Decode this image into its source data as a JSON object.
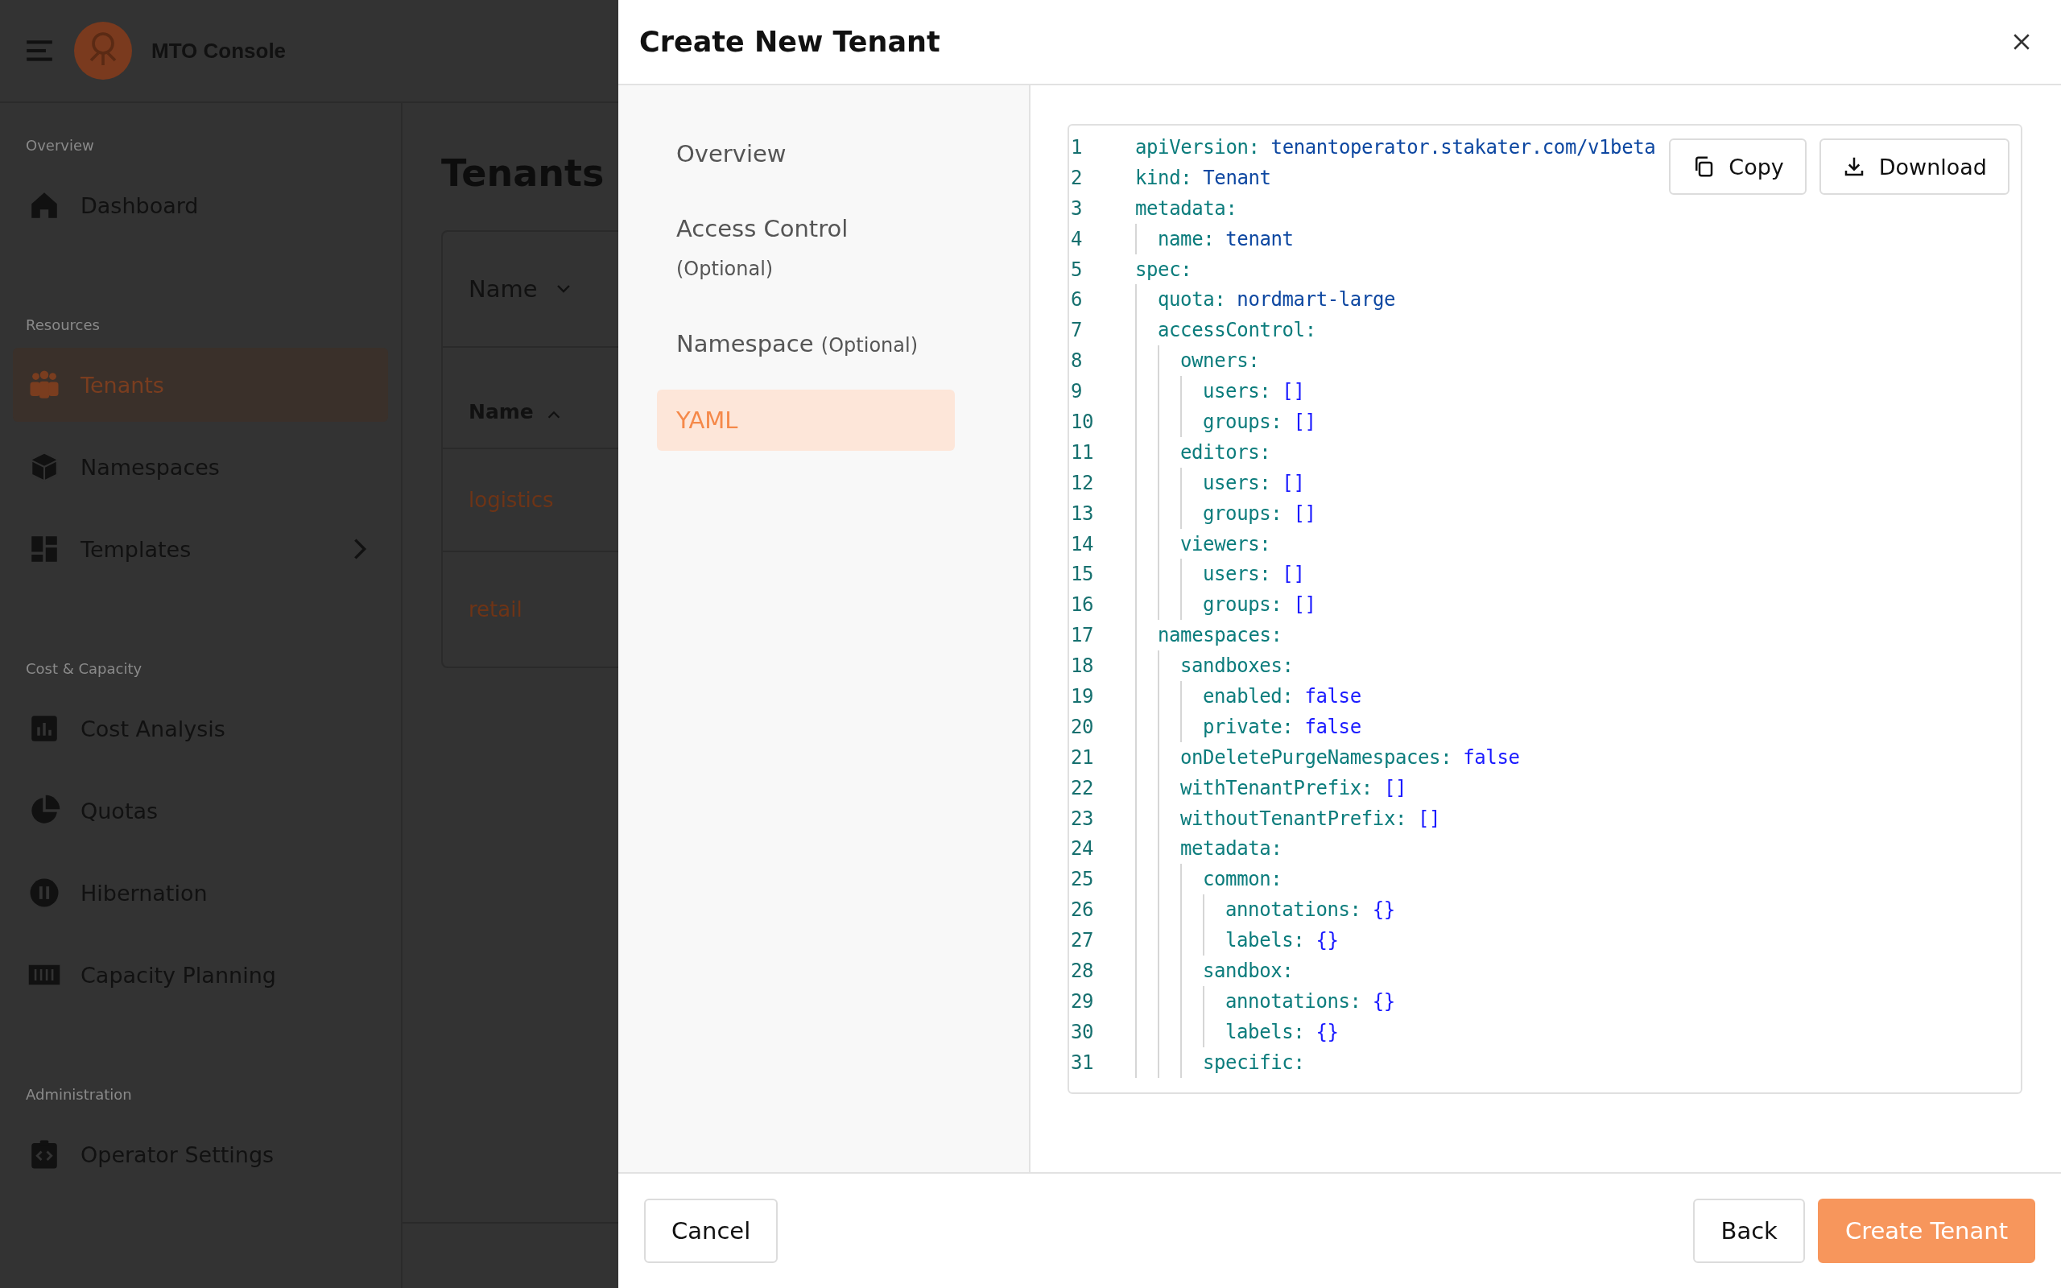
{
  "app": {
    "title": "MTO Console",
    "sidebar": [
      {
        "heading": "Overview",
        "items": [
          {
            "label": "Dashboard",
            "selected": false,
            "expandable": false
          }
        ]
      },
      {
        "heading": "Resources",
        "items": [
          {
            "label": "Tenants",
            "selected": true,
            "expandable": false
          },
          {
            "label": "Namespaces",
            "selected": false,
            "expandable": false
          },
          {
            "label": "Templates",
            "selected": false,
            "expandable": true
          }
        ]
      },
      {
        "heading": "Cost & Capacity",
        "items": [
          {
            "label": "Cost Analysis",
            "selected": false,
            "expandable": false
          },
          {
            "label": "Quotas",
            "selected": false,
            "expandable": false
          },
          {
            "label": "Hibernation",
            "selected": false,
            "expandable": false
          },
          {
            "label": "Capacity Planning",
            "selected": false,
            "expandable": false
          }
        ]
      },
      {
        "heading": "Administration",
        "items": [
          {
            "label": "Operator Settings",
            "selected": false,
            "expandable": false
          }
        ]
      }
    ],
    "main": {
      "title": "Tenants",
      "filter": {
        "label": "Name"
      },
      "table": {
        "columns": [
          {
            "label": "Name",
            "sorted_ascending": true
          }
        ],
        "rows": [
          {
            "name": "logistics"
          },
          {
            "name": "retail"
          }
        ]
      }
    }
  },
  "dialog": {
    "title": "Create New Tenant",
    "steps": [
      {
        "label": "Overview",
        "selected": false
      },
      {
        "label": "Access Control",
        "note": "(Optional)",
        "selected": false
      },
      {
        "label": "Namespace",
        "note": "(Optional)",
        "selected": false
      },
      {
        "label": "YAML",
        "selected": true
      }
    ],
    "editor": {
      "actions": [
        {
          "label": "Copy"
        },
        {
          "label": "Download"
        }
      ],
      "lines": [
        {
          "number": "1",
          "key": "apiVersion:",
          "value": "tenantoperator.stakater.com/v1beta",
          "kind": "string"
        },
        {
          "number": "2",
          "key": "kind:",
          "value": "Tenant",
          "kind": "string"
        },
        {
          "number": "3",
          "key": "metadata:",
          "kind": "mapping",
          "children": [
            {
              "number": "4",
              "key": "name:",
              "value": "tenant",
              "kind": "string"
            }
          ]
        },
        {
          "number": "5",
          "key": "spec:",
          "kind": "mapping",
          "children": [
            {
              "number": "6",
              "key": "quota:",
              "value": "nordmart-large",
              "kind": "string"
            },
            {
              "number": "7",
              "key": "accessControl:",
              "kind": "mapping",
              "children": [
                {
                  "number": "8",
                  "key": "owners:",
                  "kind": "mapping",
                  "children": [
                    {
                      "number": "9",
                      "key": "users:",
                      "value": "[]",
                      "kind": "keyword"
                    },
                    {
                      "number": "10",
                      "key": "groups:",
                      "value": "[]",
                      "kind": "keyword"
                    }
                  ]
                },
                {
                  "number": "11",
                  "key": "editors:",
                  "kind": "mapping",
                  "children": [
                    {
                      "number": "12",
                      "key": "users:",
                      "value": "[]",
                      "kind": "keyword"
                    },
                    {
                      "number": "13",
                      "key": "groups:",
                      "value": "[]",
                      "kind": "keyword"
                    }
                  ]
                },
                {
                  "number": "14",
                  "key": "viewers:",
                  "kind": "mapping",
                  "children": [
                    {
                      "number": "15",
                      "key": "users:",
                      "value": "[]",
                      "kind": "keyword"
                    },
                    {
                      "number": "16",
                      "key": "groups:",
                      "value": "[]",
                      "kind": "keyword"
                    }
                  ]
                }
              ]
            },
            {
              "number": "17",
              "key": "namespaces:",
              "kind": "mapping",
              "children": [
                {
                  "number": "18",
                  "key": "sandboxes:",
                  "kind": "mapping",
                  "children": [
                    {
                      "number": "19",
                      "key": "enabled:",
                      "value": "false",
                      "kind": "keyword"
                    },
                    {
                      "number": "20",
                      "key": "private:",
                      "value": "false",
                      "kind": "keyword"
                    }
                  ]
                },
                {
                  "number": "21",
                  "key": "onDeletePurgeNamespaces:",
                  "value": "false",
                  "kind": "keyword"
                },
                {
                  "number": "22",
                  "key": "withTenantPrefix:",
                  "value": "[]",
                  "kind": "keyword"
                },
                {
                  "number": "23",
                  "key": "withoutTenantPrefix:",
                  "value": "[]",
                  "kind": "keyword"
                },
                {
                  "number": "24",
                  "key": "metadata:",
                  "kind": "mapping",
                  "children": [
                    {
                      "number": "25",
                      "key": "common:",
                      "kind": "mapping",
                      "children": [
                        {
                          "number": "26",
                          "key": "annotations:",
                          "value": "{}",
                          "kind": "keyword"
                        },
                        {
                          "number": "27",
                          "key": "labels:",
                          "value": "{}",
                          "kind": "keyword"
                        }
                      ]
                    },
                    {
                      "number": "28",
                      "key": "sandbox:",
                      "kind": "mapping",
                      "children": [
                        {
                          "number": "29",
                          "key": "annotations:",
                          "value": "{}",
                          "kind": "keyword"
                        },
                        {
                          "number": "30",
                          "key": "labels:",
                          "value": "{}",
                          "kind": "keyword"
                        }
                      ]
                    },
                    {
                      "number": "31",
                      "key": "specific:",
                      "kind": "mapping"
                    }
                  ]
                }
              ]
            }
          ]
        }
      ]
    },
    "footer": {
      "start": [
        {
          "label": "Cancel",
          "kind": "secondary"
        }
      ],
      "end": [
        {
          "label": "Back",
          "kind": "secondary"
        },
        {
          "label": "Create Tenant",
          "kind": "primary"
        }
      ]
    }
  }
}
